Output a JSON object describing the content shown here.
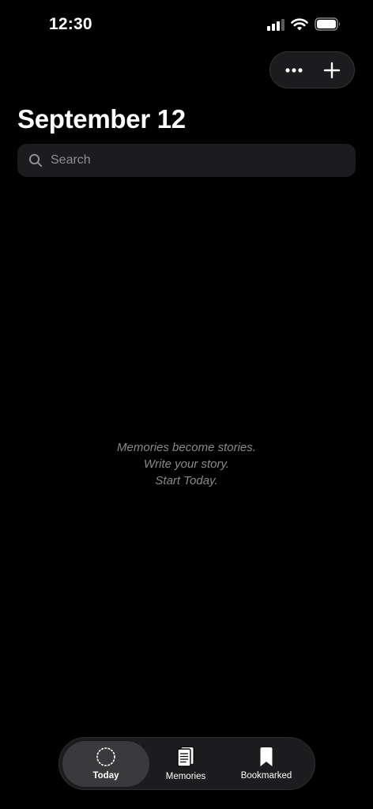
{
  "status_bar": {
    "time": "12:30",
    "icons": [
      "cellular-signal-icon",
      "wifi-icon",
      "battery-icon"
    ]
  },
  "header": {
    "actions": [
      "more-icon",
      "plus-icon"
    ],
    "title": "September 12"
  },
  "search": {
    "placeholder": "Search",
    "value": ""
  },
  "empty_state": {
    "line1": "Memories become stories.",
    "line2": "Write your story.",
    "line3": "Start Today."
  },
  "tab_bar": {
    "active": "Today",
    "tabs": [
      {
        "label": "Today",
        "icon": "dotted-circle-icon"
      },
      {
        "label": "Memories",
        "icon": "journal-icon"
      },
      {
        "label": "Bookmarked",
        "icon": "bookmark-icon"
      }
    ]
  },
  "colors": {
    "background": "#000000",
    "surface": "#1c1c1e",
    "active_tab": "#3a3a3c",
    "secondary_text": "#8a8a8e"
  }
}
